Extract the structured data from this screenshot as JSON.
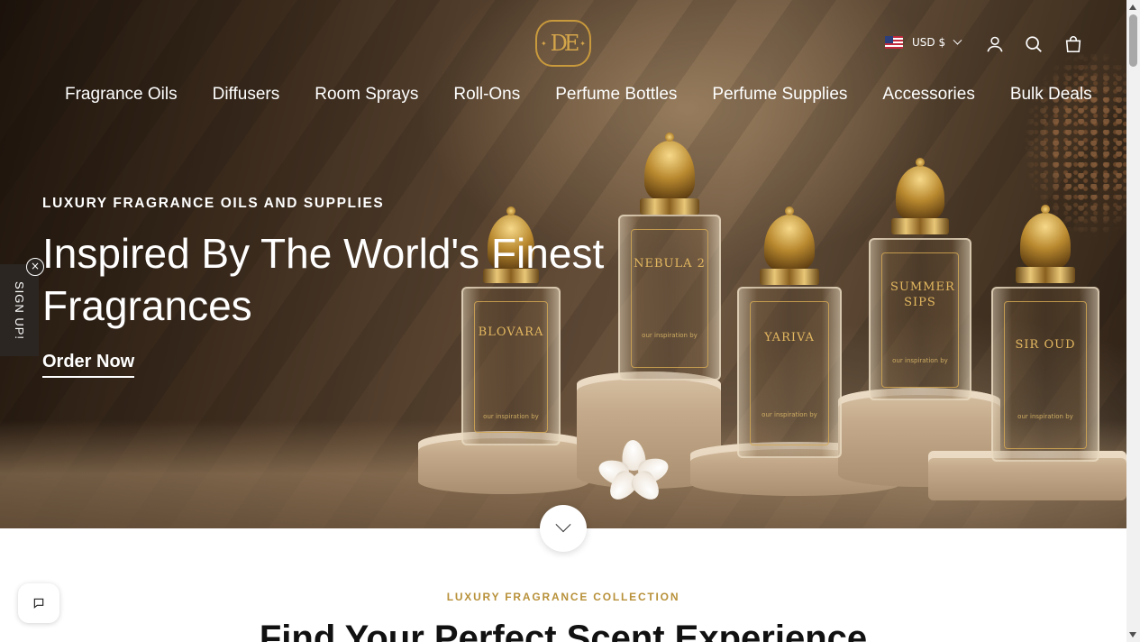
{
  "header": {
    "logo_text": "DE",
    "currency": "USD $",
    "icons": [
      "account-icon",
      "search-icon",
      "cart-icon"
    ]
  },
  "nav": {
    "items": [
      "Fragrance Oils",
      "Diffusers",
      "Room Sprays",
      "Roll-Ons",
      "Perfume Bottles",
      "Perfume Supplies",
      "Accessories",
      "Bulk Deals"
    ]
  },
  "hero": {
    "eyebrow": "LUXURY FRAGRANCE OILS AND SUPPLIES",
    "headline": "Inspired By The World's Finest Fragrances",
    "cta": "Order Now",
    "bottles": [
      {
        "name": "BLOVARA",
        "inspiration": "our inspiration by"
      },
      {
        "name": "NEBULA 2",
        "inspiration": "our inspiration by"
      },
      {
        "name": "YARIVA",
        "inspiration": "our inspiration by"
      },
      {
        "name": "SUMMER SIPS",
        "inspiration": "our inspiration by"
      },
      {
        "name": "SIR OUD",
        "inspiration": "our inspiration by"
      }
    ]
  },
  "signup_tab": {
    "label": "SIGN UP!",
    "close": "×"
  },
  "section": {
    "eyebrow": "LUXURY FRAGRANCE COLLECTION",
    "title": "Find Your Perfect Scent Experience"
  },
  "colors": {
    "accent_gold": "#b8913a",
    "logo_gold": "#c99a3c"
  }
}
